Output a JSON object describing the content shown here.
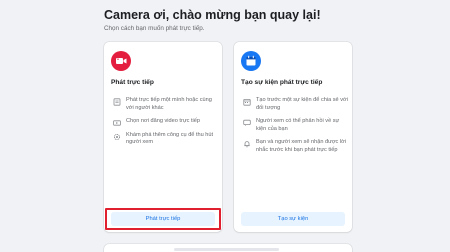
{
  "header": {
    "title": "Camera ơi, chào mừng bạn quay lại!",
    "subtitle": "Chọn cách bạn muốn phát trực tiếp."
  },
  "live_card": {
    "icon": "camera-icon",
    "icon_color": "#e41e3f",
    "heading": "Phát trực tiếp",
    "features": [
      {
        "icon": "page-icon",
        "text": "Phát trực tiếp một mình hoặc cùng với người khác"
      },
      {
        "icon": "video-icon",
        "text": "Chọn nơi đăng video trực tiếp"
      },
      {
        "icon": "gear-icon",
        "text": "Khám phá thêm công cụ để thu hút người xem"
      }
    ],
    "button_label": "Phát trực tiếp",
    "highlight_color": "#e0202e"
  },
  "event_card": {
    "icon": "calendar-icon",
    "icon_color": "#1877f2",
    "heading": "Tạo sự kiện phát trực tiếp",
    "features": [
      {
        "icon": "calendar-icon",
        "text": "Tạo trước một sự kiện để chia sẻ với đối tượng"
      },
      {
        "icon": "chat-icon",
        "text": "Người xem có thể phản hồi về sự kiện của bạn"
      },
      {
        "icon": "bell-icon",
        "text": "Bạn và người xem sẽ nhận được lời nhắc trước khi bạn phát trực tiếp"
      }
    ],
    "button_label": "Tạo sự kiện"
  },
  "colors": {
    "background": "#f0f2f5",
    "button_bg": "#e7f3ff",
    "button_text": "#1b74e4"
  }
}
